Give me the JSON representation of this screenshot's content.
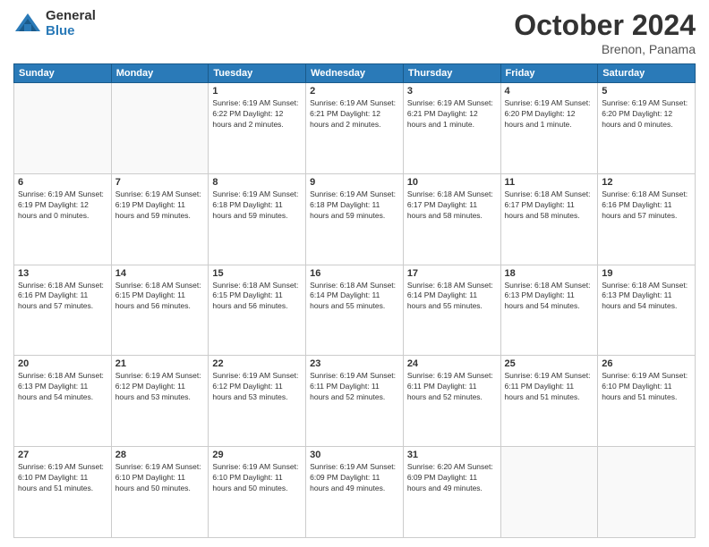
{
  "logo": {
    "general": "General",
    "blue": "Blue"
  },
  "header": {
    "month": "October 2024",
    "location": "Brenon, Panama"
  },
  "days_of_week": [
    "Sunday",
    "Monday",
    "Tuesday",
    "Wednesday",
    "Thursday",
    "Friday",
    "Saturday"
  ],
  "weeks": [
    [
      {
        "day": "",
        "info": ""
      },
      {
        "day": "",
        "info": ""
      },
      {
        "day": "1",
        "info": "Sunrise: 6:19 AM\nSunset: 6:22 PM\nDaylight: 12 hours and 2 minutes."
      },
      {
        "day": "2",
        "info": "Sunrise: 6:19 AM\nSunset: 6:21 PM\nDaylight: 12 hours and 2 minutes."
      },
      {
        "day": "3",
        "info": "Sunrise: 6:19 AM\nSunset: 6:21 PM\nDaylight: 12 hours and 1 minute."
      },
      {
        "day": "4",
        "info": "Sunrise: 6:19 AM\nSunset: 6:20 PM\nDaylight: 12 hours and 1 minute."
      },
      {
        "day": "5",
        "info": "Sunrise: 6:19 AM\nSunset: 6:20 PM\nDaylight: 12 hours and 0 minutes."
      }
    ],
    [
      {
        "day": "6",
        "info": "Sunrise: 6:19 AM\nSunset: 6:19 PM\nDaylight: 12 hours and 0 minutes."
      },
      {
        "day": "7",
        "info": "Sunrise: 6:19 AM\nSunset: 6:19 PM\nDaylight: 11 hours and 59 minutes."
      },
      {
        "day": "8",
        "info": "Sunrise: 6:19 AM\nSunset: 6:18 PM\nDaylight: 11 hours and 59 minutes."
      },
      {
        "day": "9",
        "info": "Sunrise: 6:19 AM\nSunset: 6:18 PM\nDaylight: 11 hours and 59 minutes."
      },
      {
        "day": "10",
        "info": "Sunrise: 6:18 AM\nSunset: 6:17 PM\nDaylight: 11 hours and 58 minutes."
      },
      {
        "day": "11",
        "info": "Sunrise: 6:18 AM\nSunset: 6:17 PM\nDaylight: 11 hours and 58 minutes."
      },
      {
        "day": "12",
        "info": "Sunrise: 6:18 AM\nSunset: 6:16 PM\nDaylight: 11 hours and 57 minutes."
      }
    ],
    [
      {
        "day": "13",
        "info": "Sunrise: 6:18 AM\nSunset: 6:16 PM\nDaylight: 11 hours and 57 minutes."
      },
      {
        "day": "14",
        "info": "Sunrise: 6:18 AM\nSunset: 6:15 PM\nDaylight: 11 hours and 56 minutes."
      },
      {
        "day": "15",
        "info": "Sunrise: 6:18 AM\nSunset: 6:15 PM\nDaylight: 11 hours and 56 minutes."
      },
      {
        "day": "16",
        "info": "Sunrise: 6:18 AM\nSunset: 6:14 PM\nDaylight: 11 hours and 55 minutes."
      },
      {
        "day": "17",
        "info": "Sunrise: 6:18 AM\nSunset: 6:14 PM\nDaylight: 11 hours and 55 minutes."
      },
      {
        "day": "18",
        "info": "Sunrise: 6:18 AM\nSunset: 6:13 PM\nDaylight: 11 hours and 54 minutes."
      },
      {
        "day": "19",
        "info": "Sunrise: 6:18 AM\nSunset: 6:13 PM\nDaylight: 11 hours and 54 minutes."
      }
    ],
    [
      {
        "day": "20",
        "info": "Sunrise: 6:18 AM\nSunset: 6:13 PM\nDaylight: 11 hours and 54 minutes."
      },
      {
        "day": "21",
        "info": "Sunrise: 6:19 AM\nSunset: 6:12 PM\nDaylight: 11 hours and 53 minutes."
      },
      {
        "day": "22",
        "info": "Sunrise: 6:19 AM\nSunset: 6:12 PM\nDaylight: 11 hours and 53 minutes."
      },
      {
        "day": "23",
        "info": "Sunrise: 6:19 AM\nSunset: 6:11 PM\nDaylight: 11 hours and 52 minutes."
      },
      {
        "day": "24",
        "info": "Sunrise: 6:19 AM\nSunset: 6:11 PM\nDaylight: 11 hours and 52 minutes."
      },
      {
        "day": "25",
        "info": "Sunrise: 6:19 AM\nSunset: 6:11 PM\nDaylight: 11 hours and 51 minutes."
      },
      {
        "day": "26",
        "info": "Sunrise: 6:19 AM\nSunset: 6:10 PM\nDaylight: 11 hours and 51 minutes."
      }
    ],
    [
      {
        "day": "27",
        "info": "Sunrise: 6:19 AM\nSunset: 6:10 PM\nDaylight: 11 hours and 51 minutes."
      },
      {
        "day": "28",
        "info": "Sunrise: 6:19 AM\nSunset: 6:10 PM\nDaylight: 11 hours and 50 minutes."
      },
      {
        "day": "29",
        "info": "Sunrise: 6:19 AM\nSunset: 6:10 PM\nDaylight: 11 hours and 50 minutes."
      },
      {
        "day": "30",
        "info": "Sunrise: 6:19 AM\nSunset: 6:09 PM\nDaylight: 11 hours and 49 minutes."
      },
      {
        "day": "31",
        "info": "Sunrise: 6:20 AM\nSunset: 6:09 PM\nDaylight: 11 hours and 49 minutes."
      },
      {
        "day": "",
        "info": ""
      },
      {
        "day": "",
        "info": ""
      }
    ]
  ]
}
